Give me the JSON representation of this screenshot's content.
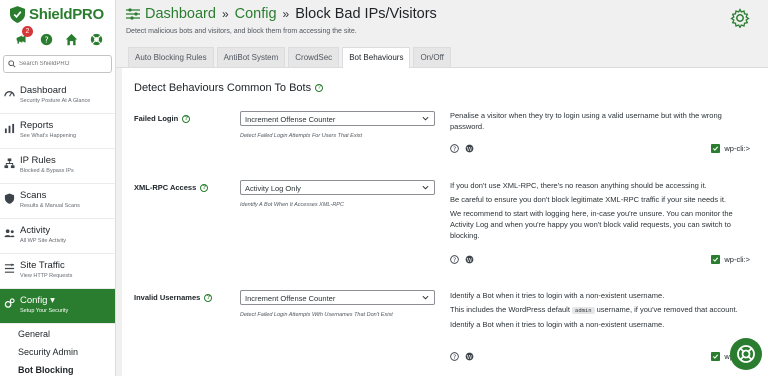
{
  "app": {
    "name": "ShieldPRO",
    "brand_color": "#2a7d2e"
  },
  "quick_icons": {
    "notifications_count": "2"
  },
  "search": {
    "placeholder": "Search ShieldPRO"
  },
  "sidebar": {
    "items": [
      {
        "label": "Dashboard",
        "sub": "Security Posture At A Glance",
        "icon": "speedometer-icon"
      },
      {
        "label": "Reports",
        "sub": "See What's Happening",
        "icon": "bar-chart-icon"
      },
      {
        "label": "IP Rules",
        "sub": "Blocked & Bypass IPs",
        "icon": "diagram-icon"
      },
      {
        "label": "Scans",
        "sub": "Results & Manual Scans",
        "icon": "shield-scan-icon"
      },
      {
        "label": "Activity",
        "sub": "All WP Site Activity",
        "icon": "people-icon"
      },
      {
        "label": "Site Traffic",
        "sub": "View HTTP Requests",
        "icon": "traffic-icon"
      },
      {
        "label": "Config ▾",
        "sub": "Setup Your Security",
        "icon": "gears-icon"
      }
    ],
    "submenu": [
      "General",
      "Security Admin",
      "Bot Blocking"
    ]
  },
  "header": {
    "crumb1": "Dashboard",
    "crumb2": "Config",
    "crumb3": "Block Bad IPs/Visitors",
    "description": "Detect malicious bots and visitors, and block them from accessing the site."
  },
  "tabs": [
    "Auto Blocking Rules",
    "AntiBot System",
    "CrowdSec",
    "Bot Behaviours",
    "On/Off"
  ],
  "section": {
    "title": "Detect Behaviours Common To Bots"
  },
  "options": [
    {
      "label": "Failed Login",
      "value": "Increment Offense Counter",
      "help": "Detect Failed Login Attempts For Users That Exist",
      "desc": [
        "Penalise a visitor when they try to login using a valid username but with the wrong password."
      ],
      "wpcli": "wp-cli:>"
    },
    {
      "label": "XML-RPC Access",
      "value": "Activity Log Only",
      "help": "Identify A Bot When It Accesses XML-RPC",
      "desc": [
        "If you don't use XML-RPC, there's no reason anything should be accessing it.",
        "Be careful to ensure you don't block legitimate XML-RPC traffic if your site needs it.",
        "We recommend to start with logging here, in-case you're unsure. You can monitor the Activity Log and when you're happy you won't block valid requests, you can switch to blocking."
      ],
      "wpcli": "wp-cli:>"
    },
    {
      "label": "Invalid Usernames",
      "value": "Increment Offense Counter",
      "help": "Detect Failed Login Attempts With Usernames That Don't Exist",
      "desc1": "Identify a Bot when it tries to login with a non-existent username.",
      "desc2_pre": "This includes the WordPress default",
      "desc2_code": "admin",
      "desc2_post": "username, if you've removed that account.",
      "desc3": "Identify a Bot when it tries to login with a non-existent username.",
      "wpcli": "wp-cli:>"
    }
  ]
}
